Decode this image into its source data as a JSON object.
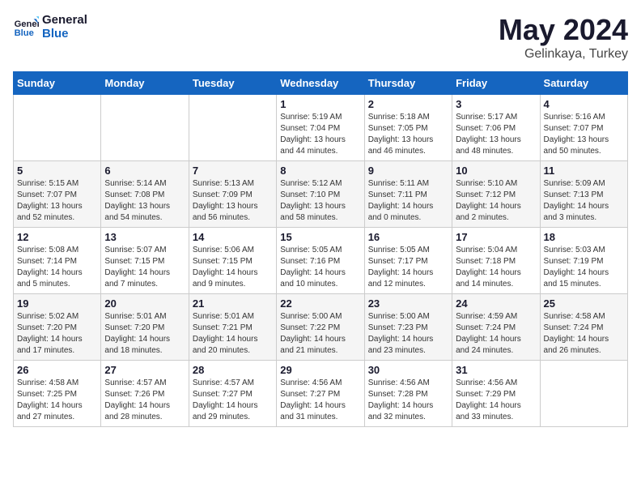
{
  "logo": {
    "text_general": "General",
    "text_blue": "Blue"
  },
  "title": "May 2024",
  "subtitle": "Gelinkaya, Turkey",
  "days_header": [
    "Sunday",
    "Monday",
    "Tuesday",
    "Wednesday",
    "Thursday",
    "Friday",
    "Saturday"
  ],
  "weeks": [
    [
      {
        "day": "",
        "sunrise": "",
        "sunset": "",
        "daylight": ""
      },
      {
        "day": "",
        "sunrise": "",
        "sunset": "",
        "daylight": ""
      },
      {
        "day": "",
        "sunrise": "",
        "sunset": "",
        "daylight": ""
      },
      {
        "day": "1",
        "sunrise": "Sunrise: 5:19 AM",
        "sunset": "Sunset: 7:04 PM",
        "daylight": "Daylight: 13 hours and 44 minutes."
      },
      {
        "day": "2",
        "sunrise": "Sunrise: 5:18 AM",
        "sunset": "Sunset: 7:05 PM",
        "daylight": "Daylight: 13 hours and 46 minutes."
      },
      {
        "day": "3",
        "sunrise": "Sunrise: 5:17 AM",
        "sunset": "Sunset: 7:06 PM",
        "daylight": "Daylight: 13 hours and 48 minutes."
      },
      {
        "day": "4",
        "sunrise": "Sunrise: 5:16 AM",
        "sunset": "Sunset: 7:07 PM",
        "daylight": "Daylight: 13 hours and 50 minutes."
      }
    ],
    [
      {
        "day": "5",
        "sunrise": "Sunrise: 5:15 AM",
        "sunset": "Sunset: 7:07 PM",
        "daylight": "Daylight: 13 hours and 52 minutes."
      },
      {
        "day": "6",
        "sunrise": "Sunrise: 5:14 AM",
        "sunset": "Sunset: 7:08 PM",
        "daylight": "Daylight: 13 hours and 54 minutes."
      },
      {
        "day": "7",
        "sunrise": "Sunrise: 5:13 AM",
        "sunset": "Sunset: 7:09 PM",
        "daylight": "Daylight: 13 hours and 56 minutes."
      },
      {
        "day": "8",
        "sunrise": "Sunrise: 5:12 AM",
        "sunset": "Sunset: 7:10 PM",
        "daylight": "Daylight: 13 hours and 58 minutes."
      },
      {
        "day": "9",
        "sunrise": "Sunrise: 5:11 AM",
        "sunset": "Sunset: 7:11 PM",
        "daylight": "Daylight: 14 hours and 0 minutes."
      },
      {
        "day": "10",
        "sunrise": "Sunrise: 5:10 AM",
        "sunset": "Sunset: 7:12 PM",
        "daylight": "Daylight: 14 hours and 2 minutes."
      },
      {
        "day": "11",
        "sunrise": "Sunrise: 5:09 AM",
        "sunset": "Sunset: 7:13 PM",
        "daylight": "Daylight: 14 hours and 3 minutes."
      }
    ],
    [
      {
        "day": "12",
        "sunrise": "Sunrise: 5:08 AM",
        "sunset": "Sunset: 7:14 PM",
        "daylight": "Daylight: 14 hours and 5 minutes."
      },
      {
        "day": "13",
        "sunrise": "Sunrise: 5:07 AM",
        "sunset": "Sunset: 7:15 PM",
        "daylight": "Daylight: 14 hours and 7 minutes."
      },
      {
        "day": "14",
        "sunrise": "Sunrise: 5:06 AM",
        "sunset": "Sunset: 7:15 PM",
        "daylight": "Daylight: 14 hours and 9 minutes."
      },
      {
        "day": "15",
        "sunrise": "Sunrise: 5:05 AM",
        "sunset": "Sunset: 7:16 PM",
        "daylight": "Daylight: 14 hours and 10 minutes."
      },
      {
        "day": "16",
        "sunrise": "Sunrise: 5:05 AM",
        "sunset": "Sunset: 7:17 PM",
        "daylight": "Daylight: 14 hours and 12 minutes."
      },
      {
        "day": "17",
        "sunrise": "Sunrise: 5:04 AM",
        "sunset": "Sunset: 7:18 PM",
        "daylight": "Daylight: 14 hours and 14 minutes."
      },
      {
        "day": "18",
        "sunrise": "Sunrise: 5:03 AM",
        "sunset": "Sunset: 7:19 PM",
        "daylight": "Daylight: 14 hours and 15 minutes."
      }
    ],
    [
      {
        "day": "19",
        "sunrise": "Sunrise: 5:02 AM",
        "sunset": "Sunset: 7:20 PM",
        "daylight": "Daylight: 14 hours and 17 minutes."
      },
      {
        "day": "20",
        "sunrise": "Sunrise: 5:01 AM",
        "sunset": "Sunset: 7:20 PM",
        "daylight": "Daylight: 14 hours and 18 minutes."
      },
      {
        "day": "21",
        "sunrise": "Sunrise: 5:01 AM",
        "sunset": "Sunset: 7:21 PM",
        "daylight": "Daylight: 14 hours and 20 minutes."
      },
      {
        "day": "22",
        "sunrise": "Sunrise: 5:00 AM",
        "sunset": "Sunset: 7:22 PM",
        "daylight": "Daylight: 14 hours and 21 minutes."
      },
      {
        "day": "23",
        "sunrise": "Sunrise: 5:00 AM",
        "sunset": "Sunset: 7:23 PM",
        "daylight": "Daylight: 14 hours and 23 minutes."
      },
      {
        "day": "24",
        "sunrise": "Sunrise: 4:59 AM",
        "sunset": "Sunset: 7:24 PM",
        "daylight": "Daylight: 14 hours and 24 minutes."
      },
      {
        "day": "25",
        "sunrise": "Sunrise: 4:58 AM",
        "sunset": "Sunset: 7:24 PM",
        "daylight": "Daylight: 14 hours and 26 minutes."
      }
    ],
    [
      {
        "day": "26",
        "sunrise": "Sunrise: 4:58 AM",
        "sunset": "Sunset: 7:25 PM",
        "daylight": "Daylight: 14 hours and 27 minutes."
      },
      {
        "day": "27",
        "sunrise": "Sunrise: 4:57 AM",
        "sunset": "Sunset: 7:26 PM",
        "daylight": "Daylight: 14 hours and 28 minutes."
      },
      {
        "day": "28",
        "sunrise": "Sunrise: 4:57 AM",
        "sunset": "Sunset: 7:27 PM",
        "daylight": "Daylight: 14 hours and 29 minutes."
      },
      {
        "day": "29",
        "sunrise": "Sunrise: 4:56 AM",
        "sunset": "Sunset: 7:27 PM",
        "daylight": "Daylight: 14 hours and 31 minutes."
      },
      {
        "day": "30",
        "sunrise": "Sunrise: 4:56 AM",
        "sunset": "Sunset: 7:28 PM",
        "daylight": "Daylight: 14 hours and 32 minutes."
      },
      {
        "day": "31",
        "sunrise": "Sunrise: 4:56 AM",
        "sunset": "Sunset: 7:29 PM",
        "daylight": "Daylight: 14 hours and 33 minutes."
      },
      {
        "day": "",
        "sunrise": "",
        "sunset": "",
        "daylight": ""
      }
    ]
  ]
}
